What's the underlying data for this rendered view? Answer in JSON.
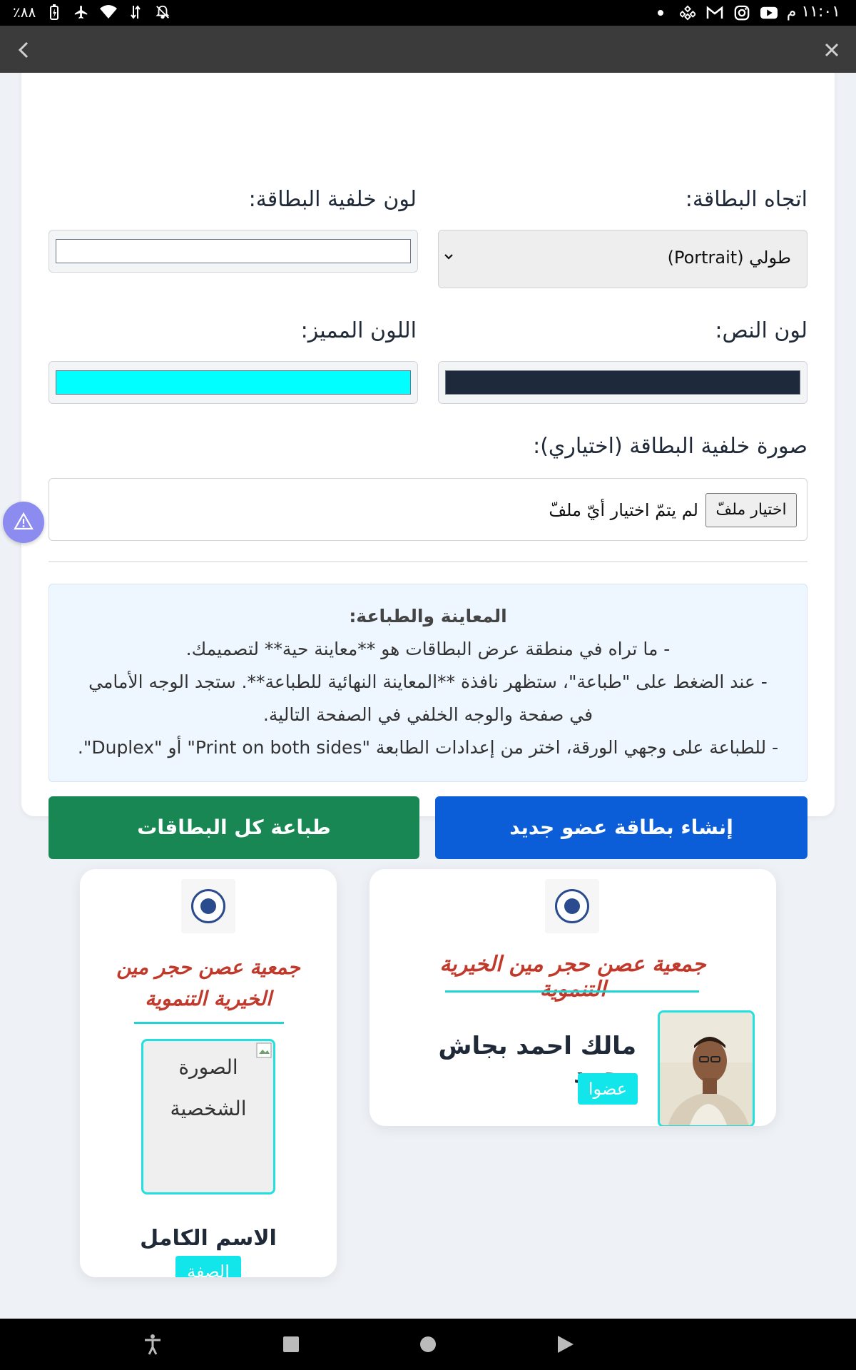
{
  "status_bar": {
    "time": "١١:٠١ م",
    "battery_percent": "٪٨٨"
  },
  "form": {
    "orientation_label": "اتجاه البطاقة:",
    "orientation_value": "طولي (Portrait)",
    "bg_color_label": "لون خلفية البطاقة:",
    "bg_color_value": "#ffffff",
    "text_color_label": "لون النص:",
    "text_color_value": "#1e293b",
    "accent_color_label": "اللون المميز:",
    "accent_color_value": "#00ffff",
    "bg_image_label": "صورة خلفية البطاقة (اختياري):",
    "file_button_label": "اختيار ملفّ",
    "file_status": "لم يتمّ اختيار أيّ ملفّ"
  },
  "info": {
    "title": "المعاينة والطباعة:",
    "line1": "- ما تراه في منطقة عرض البطاقات هو **معاينة حية** لتصميمك.",
    "line2a": "- عند الضغط على \"طباعة\"، ستظهر نافذة **المعاينة النهائية للطباعة**. ستجد الوجه الأمامي",
    "line2b": "في صفحة والوجه الخلفي في الصفحة التالية.",
    "line3": "- للطباعة على وجهي الورقة، اختر من إعدادات الطابعة \"Print on both sides\" أو \"Duplex\"."
  },
  "actions": {
    "create_label": "إنشاء بطاقة عضو جديد",
    "print_all_label": "طباعة كل البطاقات"
  },
  "cards": {
    "landscape": {
      "org_name": "جمعية عصن حجر مين الخيرية التنموية",
      "member_name": "مالك احمد بجاش محمد",
      "role": "عضوا"
    },
    "portrait": {
      "org_name": "جمعية عصن حجر مين الخيرية التنموية",
      "photo_alt": "الصورة الشخصية",
      "full_name": "الاسم الكامل",
      "role": "الصفة"
    }
  }
}
